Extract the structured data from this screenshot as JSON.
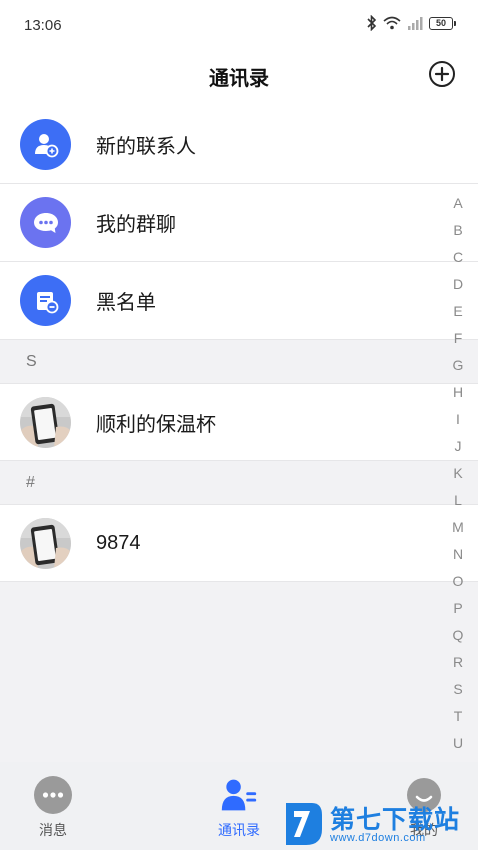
{
  "status_bar": {
    "time": "13:06",
    "battery": "50"
  },
  "header": {
    "title": "通讯录"
  },
  "menu": [
    {
      "label": "新的联系人",
      "icon": "add-contact-icon",
      "color": "#3d6ef5"
    },
    {
      "label": "我的群聊",
      "icon": "group-chat-icon",
      "color": "#6b73f0"
    },
    {
      "label": "黑名单",
      "icon": "blacklist-icon",
      "color": "#3d6ef5"
    }
  ],
  "sections": [
    {
      "letter": "S",
      "contacts": [
        {
          "name": "顺利的保温杯"
        }
      ]
    },
    {
      "letter": "#",
      "contacts": [
        {
          "name": "9874"
        }
      ]
    }
  ],
  "index_letters": [
    "A",
    "B",
    "C",
    "D",
    "E",
    "F",
    "G",
    "H",
    "I",
    "J",
    "K",
    "L",
    "M",
    "N",
    "O",
    "P",
    "Q",
    "R",
    "S",
    "T",
    "U"
  ],
  "tabs": [
    {
      "label": "消息",
      "icon": "message-icon"
    },
    {
      "label": "通讯录",
      "icon": "contacts-icon",
      "active": true
    },
    {
      "label": "我的",
      "icon": "profile-icon"
    }
  ],
  "watermark": {
    "text": "第七下载站",
    "url": "www.d7down.com"
  },
  "colors": {
    "accent": "#2f6bff",
    "background": "#f2f2f4"
  }
}
